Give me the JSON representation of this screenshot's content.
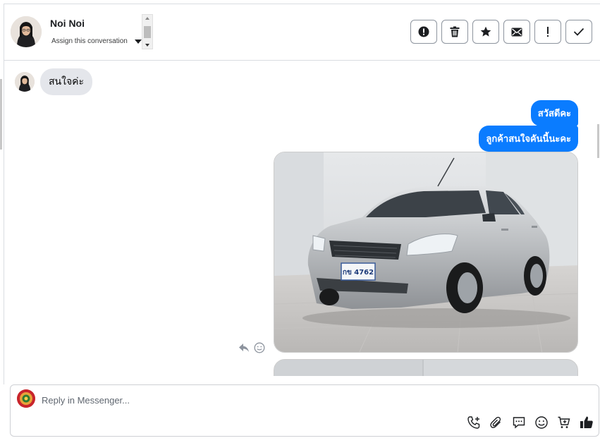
{
  "header": {
    "contact_name": "Noi Noi",
    "assign_label": "Assign this conversation",
    "actions": [
      {
        "name": "mark-spam-button",
        "icon": "alert-circle-icon"
      },
      {
        "name": "delete-button",
        "icon": "trash-icon"
      },
      {
        "name": "star-button",
        "icon": "star-icon"
      },
      {
        "name": "mark-unread-button",
        "icon": "envelope-icon"
      },
      {
        "name": "follow-up-button",
        "icon": "exclamation-icon"
      },
      {
        "name": "mark-done-button",
        "icon": "check-icon"
      }
    ]
  },
  "thread": {
    "incoming": [
      {
        "text": "สนใจค่ะ"
      }
    ],
    "outgoing": [
      {
        "text": "สวัสดีคะ"
      },
      {
        "text": "ลูกค้าสนใจคันนี้นะคะ"
      }
    ],
    "photo": {
      "icon": "car-photo",
      "plate": "กข 4762"
    }
  },
  "composer": {
    "placeholder": "Reply in Messenger...",
    "icons": [
      "phone-plus-icon",
      "paperclip-icon",
      "saved-reply-icon",
      "emoji-icon",
      "cart-plus-icon",
      "thumbs-up-icon"
    ]
  },
  "colors": {
    "accent": "#0a7cff",
    "incoming_bubble": "#e4e6eb",
    "border": "#dadde1"
  }
}
